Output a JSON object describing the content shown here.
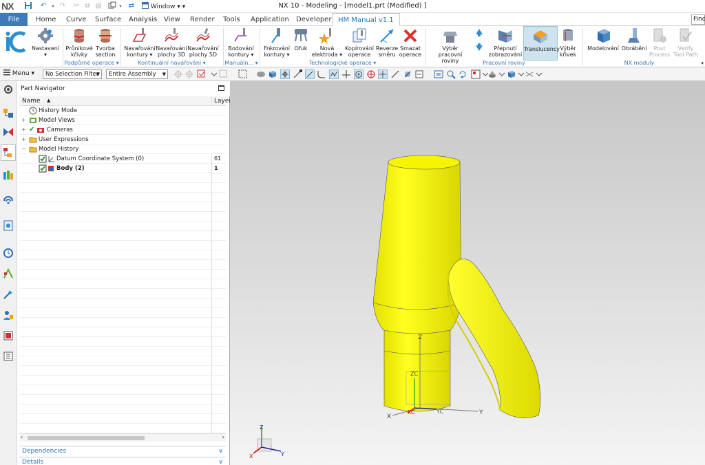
{
  "title": {
    "logo": "NX",
    "window_menu": "Window",
    "window_title": "NX 10 - Modeling - [model1.prt (Modified) ]"
  },
  "menubar": {
    "file": "File",
    "tabs": [
      "Home",
      "Curve",
      "Surface",
      "Analysis",
      "View",
      "Render",
      "Tools",
      "Application",
      "Developer"
    ],
    "active_tab": "HM Manual v1.1",
    "search": "Find"
  },
  "ribbon": {
    "buttons": [
      {
        "l1": "",
        "l2": ""
      },
      {
        "l1": "Nastavení",
        "l2": "▾"
      },
      {
        "l1": "Průnikové",
        "l2": "křivky"
      },
      {
        "l1": "Tvorba",
        "l2": "section"
      },
      {
        "l1": "Navařování",
        "l2": "kontury ▾"
      },
      {
        "l1": "Navařování",
        "l2": "plochy 3D"
      },
      {
        "l1": "Navařování",
        "l2": "plochy 5D"
      },
      {
        "l1": "Bodování",
        "l2": "kontury ▾"
      },
      {
        "l1": "Frézování",
        "l2": "kontury ▾"
      },
      {
        "l1": "Ofuk",
        "l2": ""
      },
      {
        "l1": "Nová",
        "l2": "elektroda ▾"
      },
      {
        "l1": "Kopírování",
        "l2": "operace"
      },
      {
        "l1": "Reverze",
        "l2": "směru"
      },
      {
        "l1": "Smazat",
        "l2": "operace"
      },
      {
        "l1": "Výběr pracovní",
        "l2": "roviny"
      },
      {
        "l1": "Přepnutí",
        "l2": "zobrazování"
      },
      {
        "l1": "Translucency",
        "l2": ""
      },
      {
        "l1": "Výběr",
        "l2": "křivek"
      },
      {
        "l1": "Modelování",
        "l2": ""
      },
      {
        "l1": "Obrábění",
        "l2": ""
      },
      {
        "l1": "Post",
        "l2": "Process"
      },
      {
        "l1": "Verify",
        "l2": "Tool Path"
      }
    ],
    "groups": [
      "Podpůrné operace",
      "Kontinuální navařování",
      "Manuáln...",
      "Technologické operace",
      "Pracovní roviny",
      "NX moduly"
    ]
  },
  "toolbar": {
    "menu": "Menu",
    "selection_filter": "No Selection Filter",
    "scope": "Entire Assembly"
  },
  "navigator": {
    "title": "Part Navigator",
    "col_name": "Name",
    "col_layer": "Layer",
    "rows": [
      {
        "label": "History Mode",
        "layer": ""
      },
      {
        "label": "Model Views",
        "layer": ""
      },
      {
        "label": "Cameras",
        "layer": ""
      },
      {
        "label": "User Expressions",
        "layer": ""
      },
      {
        "label": "Model History",
        "layer": ""
      },
      {
        "label": "Datum Coordinate System (0)",
        "layer": "61"
      },
      {
        "label": "Body (2)",
        "layer": "1"
      }
    ],
    "sections": [
      "Dependencies",
      "Details"
    ]
  },
  "viewport": {
    "body_color": "#f0ef00",
    "axis_labels": {
      "z": "Z",
      "zc": "ZC",
      "y": "Y",
      "yc": "YC",
      "x": "X",
      "xc": "XC"
    },
    "triad_labels": {
      "z": "Z",
      "y": "Y",
      "x": "X"
    }
  }
}
